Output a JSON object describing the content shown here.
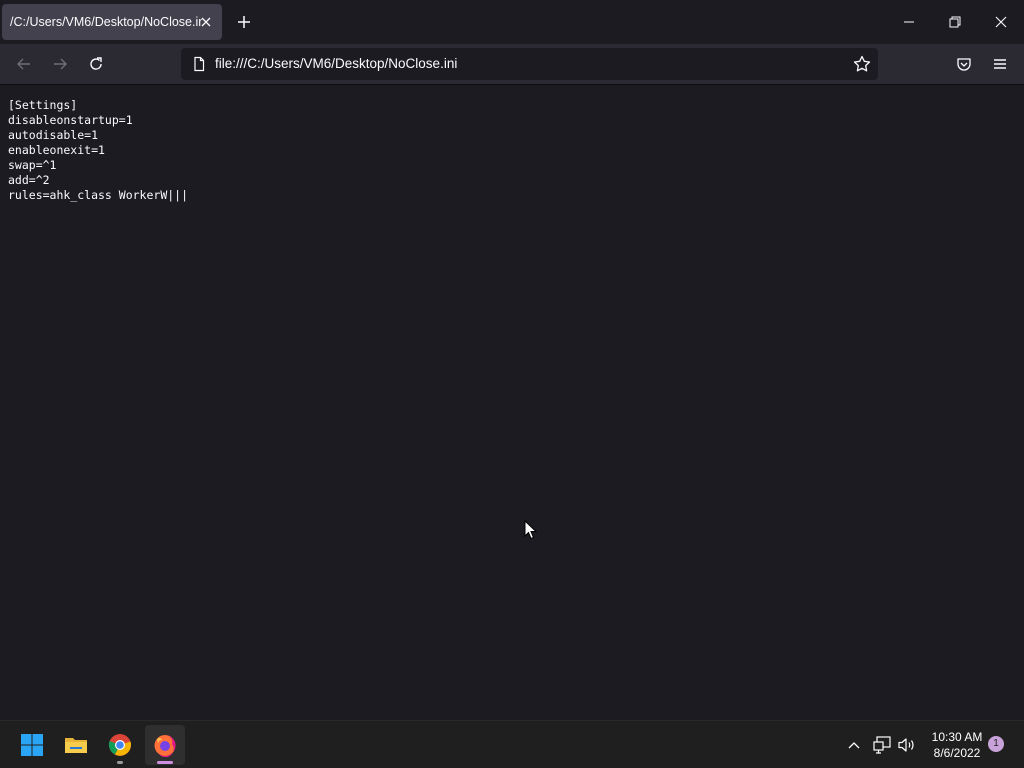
{
  "browser": {
    "tab": {
      "title": "/C:/Users/VM6/Desktop/NoClose.ini"
    },
    "url": "file:///C:/Users/VM6/Desktop/NoClose.ini"
  },
  "icons": {
    "tab_close": "close-icon",
    "new_tab": "plus-icon",
    "minimize": "minimize-icon",
    "restore": "restore-icon",
    "close_window": "close-icon",
    "back": "back-arrow-icon",
    "forward": "forward-arrow-icon",
    "reload": "reload-icon",
    "page": "page-icon",
    "bookmark": "star-icon",
    "pocket": "pocket-icon",
    "menu": "hamburger-menu-icon"
  },
  "file_content": "[Settings]\ndisableonstartup=1\nautodisable=1\nenableonexit=1\nswap=^1\nadd=^2\nrules=ahk_class WorkerW|||",
  "taskbar": {
    "apps": [
      "start-menu",
      "file-explorer",
      "chrome",
      "firefox"
    ],
    "clock": {
      "time": "10:30 AM",
      "date": "8/6/2022"
    },
    "notification_count": "1"
  },
  "colors": {
    "tab_active": "#42414d",
    "toolbar": "#2b2a33",
    "content_bg": "#1c1b22",
    "taskbar": "#1f1f1f",
    "accent_indicator": "#d08ee0"
  }
}
